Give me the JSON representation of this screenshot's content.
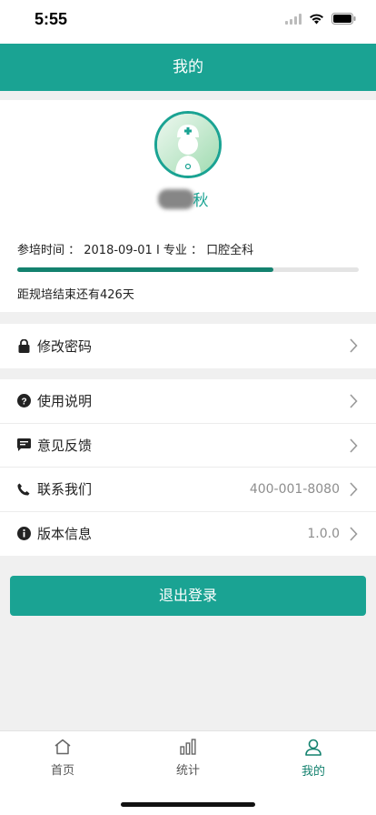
{
  "status_bar": {
    "time": "5:55"
  },
  "navbar": {
    "title": "我的"
  },
  "profile": {
    "name_visible": "秋",
    "info": "参培时间 ： 2018-09-01  I  专业 ： 口腔全科",
    "progress": 0.75,
    "remaining": "距规培结束还有426天"
  },
  "menu": {
    "change_password": "修改密码",
    "instructions": "使用说明",
    "feedback": "意见反馈",
    "contact": "联系我们",
    "contact_value": "400-001-8080",
    "version": "版本信息",
    "version_value": "1.0.0"
  },
  "logout": "退出登录",
  "tabs": {
    "home": "首页",
    "stats": "统计",
    "mine": "我的"
  },
  "colors": {
    "accent": "#1aa393",
    "progress": "#14826f"
  },
  "icons": [
    "lock-icon",
    "question-icon",
    "message-icon",
    "phone-icon",
    "info-icon",
    "chevron-right-icon",
    "home-icon",
    "bar-chart-icon",
    "user-icon"
  ]
}
